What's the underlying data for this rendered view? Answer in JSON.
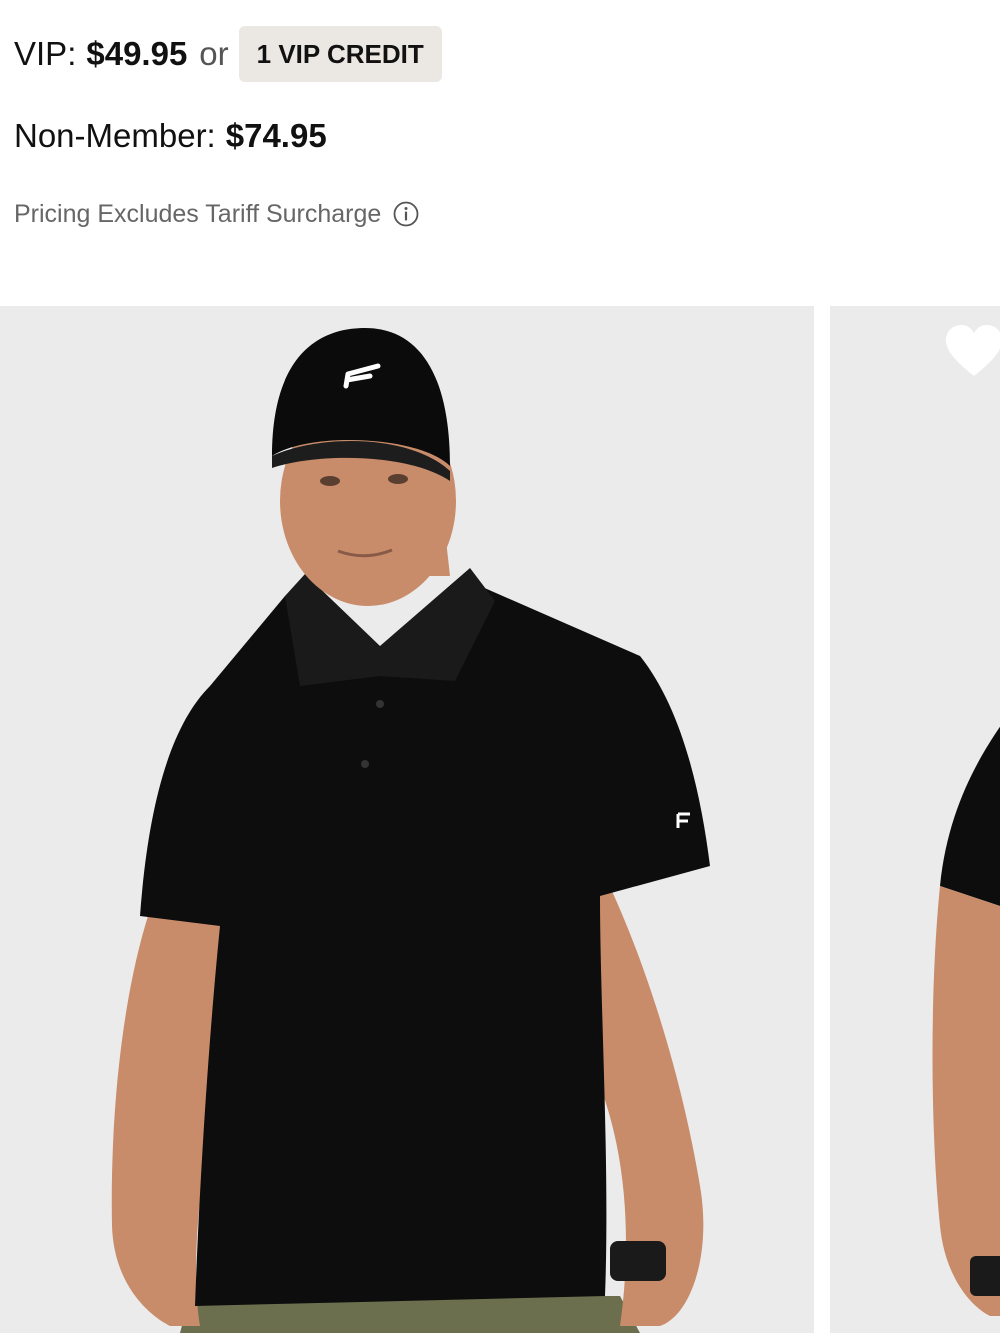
{
  "pricing": {
    "vip_label": "VIP:",
    "vip_price": "$49.95",
    "or_text": "or",
    "credit_badge": "1 VIP CREDIT",
    "nonmember_label": "Non-Member:",
    "nonmember_price": "$74.95",
    "tariff_note": "Pricing Excludes Tariff Surcharge"
  },
  "icons": {
    "info": "info-circle-icon",
    "favorite": "heart-icon"
  },
  "colors": {
    "badge_bg": "#ebe8e3",
    "photo_bg": "#ebebeb",
    "text_primary": "#111111",
    "text_muted": "#666666"
  }
}
